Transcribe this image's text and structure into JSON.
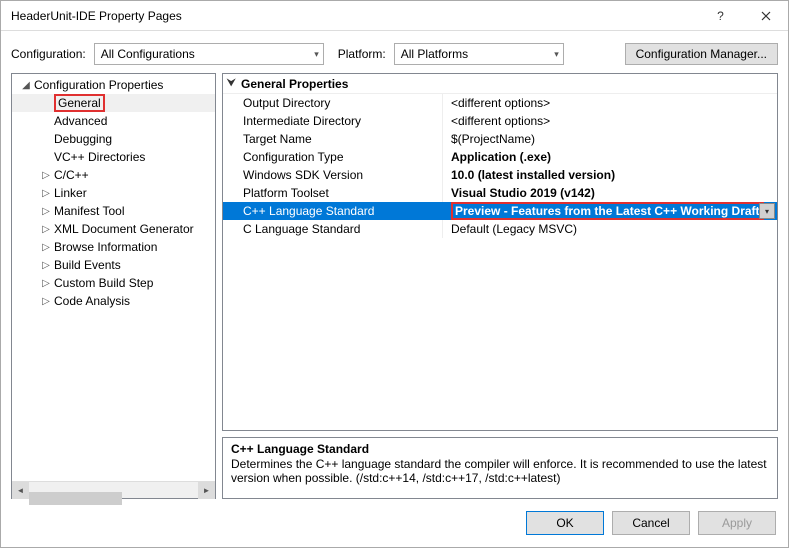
{
  "window": {
    "title": "HeaderUnit-IDE Property Pages"
  },
  "toolbar": {
    "configuration_label": "Configuration:",
    "configuration_value": "All Configurations",
    "platform_label": "Platform:",
    "platform_value": "All Platforms",
    "config_manager_label": "Configuration Manager..."
  },
  "tree": {
    "root": "Configuration Properties",
    "items": [
      {
        "label": "General",
        "expandable": false,
        "selected": true,
        "highlighted": true
      },
      {
        "label": "Advanced",
        "expandable": false
      },
      {
        "label": "Debugging",
        "expandable": false
      },
      {
        "label": "VC++ Directories",
        "expandable": false
      },
      {
        "label": "C/C++",
        "expandable": true
      },
      {
        "label": "Linker",
        "expandable": true
      },
      {
        "label": "Manifest Tool",
        "expandable": true
      },
      {
        "label": "XML Document Generator",
        "expandable": true
      },
      {
        "label": "Browse Information",
        "expandable": true
      },
      {
        "label": "Build Events",
        "expandable": true
      },
      {
        "label": "Custom Build Step",
        "expandable": true
      },
      {
        "label": "Code Analysis",
        "expandable": true
      }
    ]
  },
  "grid": {
    "header": "General Properties",
    "rows": [
      {
        "key": "Output Directory",
        "value": "<different options>",
        "bold": false
      },
      {
        "key": "Intermediate Directory",
        "value": "<different options>",
        "bold": false
      },
      {
        "key": "Target Name",
        "value": "$(ProjectName)",
        "bold": false
      },
      {
        "key": "Configuration Type",
        "value": "Application (.exe)",
        "bold": true
      },
      {
        "key": "Windows SDK Version",
        "value": "10.0 (latest installed version)",
        "bold": true
      },
      {
        "key": "Platform Toolset",
        "value": "Visual Studio 2019 (v142)",
        "bold": true
      },
      {
        "key": "C++ Language Standard",
        "value": "Preview - Features from the Latest C++ Working Draft",
        "selected": true,
        "highlighted": true,
        "dropdown": true,
        "bold": true
      },
      {
        "key": "C Language Standard",
        "value": "Default (Legacy MSVC)",
        "bold": false
      }
    ]
  },
  "description": {
    "title": "C++ Language Standard",
    "body": "Determines the C++ language standard the compiler will enforce. It is recommended to use the latest version when possible.  (/std:c++14, /std:c++17, /std:c++latest)"
  },
  "buttons": {
    "ok": "OK",
    "cancel": "Cancel",
    "apply": "Apply"
  }
}
